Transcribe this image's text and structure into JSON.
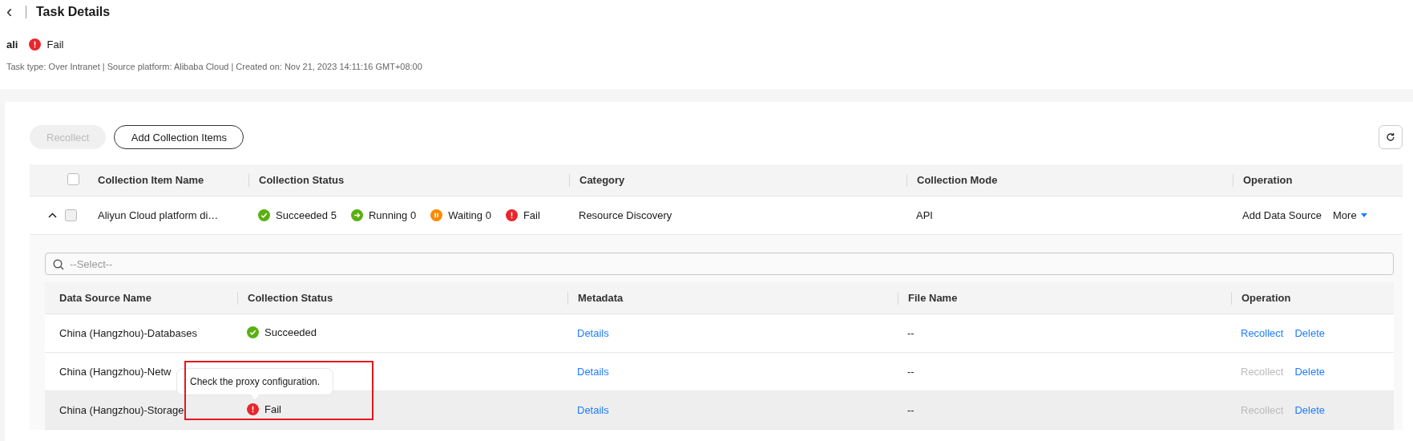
{
  "header": {
    "back": "‹",
    "title": "Task Details"
  },
  "task": {
    "name": "ali",
    "status": {
      "kind": "fail",
      "label": "Fail"
    },
    "meta": "Task type: Over Intranet | Source platform: Alibaba Cloud | Created on: Nov 21, 2023 14:11:16 GMT+08:00"
  },
  "toolbar": {
    "buttons": [
      {
        "label": "Recollect",
        "disabled": true,
        "kind": "secondary"
      },
      {
        "label": "Add Collection Items",
        "disabled": false,
        "kind": "outline"
      }
    ]
  },
  "table": {
    "select_all": {
      "checked": false
    },
    "columns": [
      "Collection Item Name",
      "Collection Status",
      "Category",
      "Collection Mode",
      "Operation"
    ],
    "rows": [
      {
        "expanded": true,
        "checked": false,
        "name": "Aliyun Cloud platform di…",
        "statuses": [
          {
            "kind": "succeeded",
            "label": "Succeeded 5"
          },
          {
            "kind": "running",
            "label": "Running 0"
          },
          {
            "kind": "waiting",
            "label": "Waiting 0"
          },
          {
            "kind": "fail",
            "label": "Fail"
          }
        ],
        "category": "Resource Discovery",
        "mode": "API",
        "actions": [
          "Add Data Source"
        ],
        "more": "More",
        "detail": {
          "search": {
            "placeholder": "--Select--"
          },
          "columns": [
            "Data Source Name",
            "Collection Status",
            "Metadata",
            "File Name",
            "Operation"
          ],
          "rows": [
            {
              "name": "China (Hangzhou)-Databases",
              "status": {
                "kind": "succeeded",
                "label": "Succeeded"
              },
              "metadata": "Details",
              "file": "--",
              "recollect": {
                "label": "Recollect",
                "disabled": false
              },
              "delete": "Delete",
              "highlighted": false
            },
            {
              "name": "China (Hangzhou)-Netw",
              "metadata": "Details",
              "file": "--",
              "recollect": {
                "label": "Recollect",
                "disabled": true
              },
              "delete": "Delete",
              "highlighted": false
            },
            {
              "name": "China (Hangzhou)-Storage",
              "status": {
                "kind": "fail",
                "label": "Fail"
              },
              "tooltip": "Check the proxy configuration.",
              "metadata": "Details",
              "file": "--",
              "recollect": {
                "label": "Recollect",
                "disabled": true
              },
              "delete": "Delete",
              "highlighted": true
            }
          ]
        }
      }
    ]
  }
}
